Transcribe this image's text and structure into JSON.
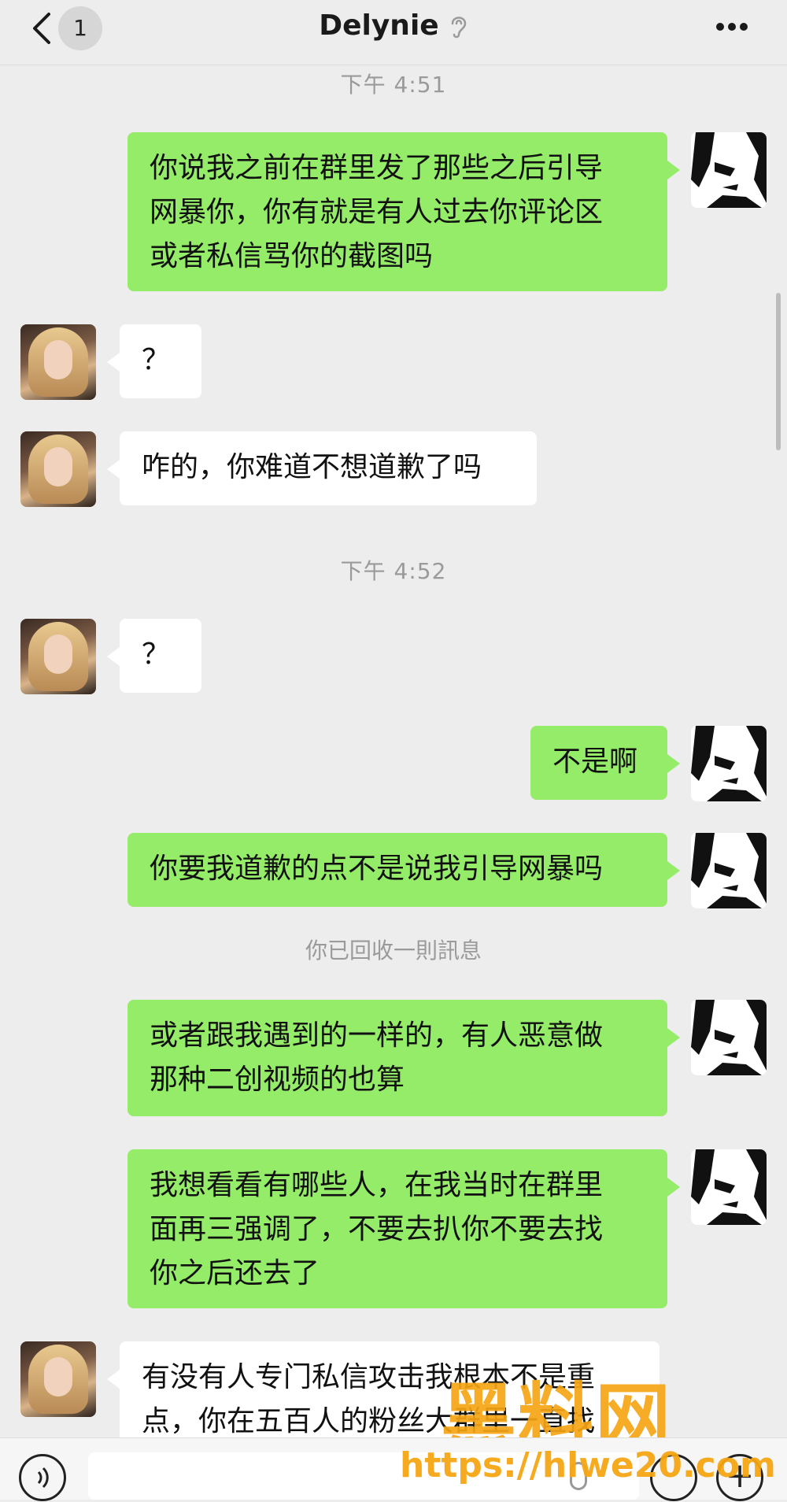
{
  "header": {
    "unread_count": "1",
    "title": "Delynie",
    "icons": {
      "back": "chevron-left-icon",
      "mute": "ear-icon",
      "more": "more-dots-icon"
    }
  },
  "timestamps": [
    "下午 4:51",
    "下午 4:52"
  ],
  "messages": [
    {
      "side": "out",
      "text": "你说我之前在群里发了那些之后引导\n网暴你，你有就是有人过去你评论区\n或者私信骂你的截图吗"
    },
    {
      "side": "in",
      "text": "？"
    },
    {
      "side": "in",
      "text": "咋的，你难道不想道歉了吗"
    },
    {
      "side": "in",
      "text": "？"
    },
    {
      "side": "out",
      "text": "不是啊"
    },
    {
      "side": "out",
      "text": "你要我道歉的点不是说我引导网暴吗"
    },
    {
      "side": "out",
      "text": "或者跟我遇到的一样的，有人恶意做\n那种二创视频的也算"
    },
    {
      "side": "out",
      "text": "我想看看有哪些人，在我当时在群里\n面再三强调了，不要去扒你不要去找\n你之后还去了"
    },
    {
      "side": "in",
      "text": "有没有人专门私信攻击我根本不是重\n点，你在五百人的粉丝大群里一直找"
    }
  ],
  "system_notice": "你已回收一則訊息",
  "watermark": {
    "logo": "黑料网",
    "url": "https://hlwe20.com"
  },
  "input_bar": {
    "icons": {
      "voice": "voice-icon",
      "mic": "mic-icon",
      "emoji": "emoji-icon",
      "plus": "plus-icon"
    }
  },
  "colors": {
    "outgoing_bubble": "#95ec69",
    "incoming_bubble": "#ffffff",
    "background": "#ededed",
    "watermark": "#f5a514"
  }
}
